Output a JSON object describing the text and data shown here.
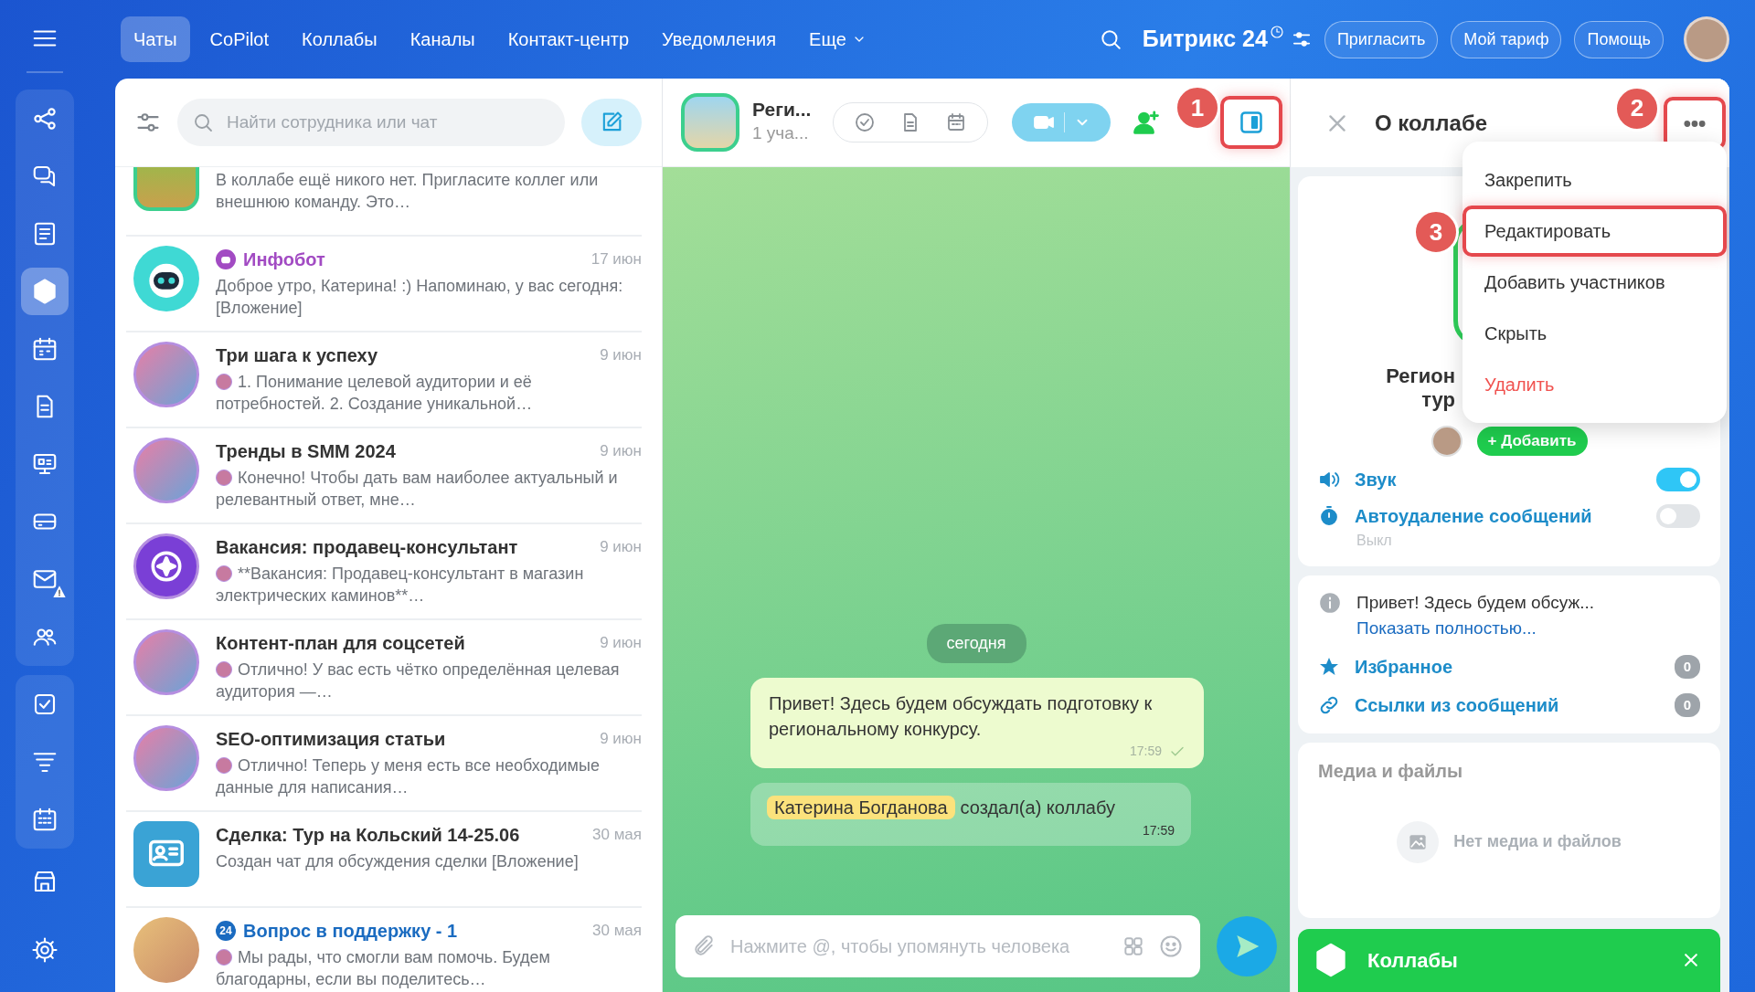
{
  "rail": {
    "top": [
      {
        "kind": "menu",
        "selected": false
      }
    ],
    "groups": [
      [
        {
          "kind": "flow",
          "selected": false,
          "alert": false
        },
        {
          "kind": "chat",
          "selected": false,
          "alert": false
        },
        {
          "kind": "news",
          "selected": false,
          "alert": false
        },
        {
          "kind": "collab",
          "selected": true,
          "alert": false
        },
        {
          "kind": "calendar",
          "selected": false,
          "alert": false
        },
        {
          "kind": "doc",
          "selected": false,
          "alert": false
        },
        {
          "kind": "board",
          "selected": false,
          "alert": false
        },
        {
          "kind": "drive",
          "selected": false,
          "alert": false
        },
        {
          "kind": "mail",
          "selected": false,
          "alert": true
        },
        {
          "kind": "people",
          "selected": false,
          "alert": false
        }
      ],
      [
        {
          "kind": "tasks",
          "selected": false,
          "alert": false
        },
        {
          "kind": "filter",
          "selected": false,
          "alert": false
        },
        {
          "kind": "planner",
          "selected": false,
          "alert": false
        }
      ]
    ],
    "bottom": [
      {
        "kind": "store",
        "selected": false
      },
      {
        "kind": "settings",
        "selected": false
      }
    ]
  },
  "tabs": [
    {
      "label": "Чаты",
      "selected": true,
      "dropdown": false
    },
    {
      "label": "CoPilot",
      "selected": false,
      "dropdown": false
    },
    {
      "label": "Коллабы",
      "selected": false,
      "dropdown": false
    },
    {
      "label": "Каналы",
      "selected": false,
      "dropdown": false
    },
    {
      "label": "Контакт-центр",
      "selected": false,
      "dropdown": false
    },
    {
      "label": "Уведомления",
      "selected": false,
      "dropdown": false
    },
    {
      "label": "Еще",
      "selected": false,
      "dropdown": true
    }
  ],
  "brand": "Битрикс 24",
  "header_buttons": [
    "Пригласить",
    "Мой тариф",
    "Помощь"
  ],
  "search": {
    "placeholder": "Найти сотрудника или чат"
  },
  "chats": [
    {
      "kind": "collab",
      "bot_badge": false,
      "preview": "В коллабе ещё никого нет. Пригласите коллег или внешнюю команду. Это…",
      "preview_avatar": false
    },
    {
      "kind": "bot",
      "name": "Инфобот",
      "bot_badge": true,
      "color": "#a24bc3",
      "date": "17 июн",
      "preview": "Доброе утро, Катерина! :) Напоминаю, у вас сегодня: [Вложение]",
      "preview_avatar": false
    },
    {
      "kind": "photo",
      "bot_badge": false,
      "name": "Три шага к успеху",
      "color": "#333333",
      "date": "9 июн",
      "preview": "1. Понимание целевой аудитории и её потребностей. 2. Создание уникальной…",
      "preview_avatar": true
    },
    {
      "kind": "photo",
      "bot_badge": false,
      "name": "Тренды в SMM 2024",
      "color": "#333333",
      "date": "9 июн",
      "preview": "Конечно! Чтобы дать вам наиболее актуальный и релевантный ответ, мне…",
      "preview_avatar": true
    },
    {
      "kind": "logo",
      "bot_badge": false,
      "name": "Вакансия: продавец-консультант",
      "color": "#333333",
      "date": "9 июн",
      "preview": "**Вакансия: Продавец-консультант в магазин электрических каминов**…",
      "preview_avatar": true
    },
    {
      "kind": "photo",
      "bot_badge": false,
      "name": "Контент-план для соцсетей",
      "color": "#333333",
      "date": "9 июн",
      "preview": "Отлично! У вас есть чётко определённая целевая аудитория —…",
      "preview_avatar": true
    },
    {
      "kind": "photo",
      "bot_badge": false,
      "name": "SEO-оптимизация статьи",
      "color": "#333333",
      "date": "9 июн",
      "preview": "Отлично! Теперь у меня есть все необходимые данные для написания…",
      "preview_avatar": true
    },
    {
      "kind": "deal",
      "bot_badge": false,
      "name": "Сделка: Тур на Кольский 14-25.06",
      "color": "#333333",
      "date": "30 мая",
      "preview": "Создан чат для обсуждения сделки [Вложение]",
      "preview_avatar": false
    },
    {
      "kind": "group",
      "bot_badge": false,
      "name": "Вопрос в поддержку - 1",
      "name_badge": "24",
      "color": "#1a6bc0",
      "date": "30 мая",
      "preview": "Мы рады, что смогли вам помочь. Будем благодарны, если вы поделитесь…",
      "preview_avatar": true
    }
  ],
  "chat": {
    "title": "Реги...",
    "subtitle": "1 уча...",
    "panel_callout": "1",
    "date_divider": "сегодня",
    "messages": [
      {
        "kind": "text",
        "text": "Привет! Здесь будем обсуждать подготовку к региональному конкурсу.",
        "time": "17:59",
        "read": true
      },
      {
        "kind": "system",
        "author": "Катерина Богданова",
        "text": "создал(а) коллабу",
        "time": "17:59"
      }
    ],
    "input": {
      "placeholder": "Нажмите @, чтобы упомянуть человека"
    }
  },
  "info": {
    "title": "О коллабе",
    "more_callout": "2",
    "menu": [
      {
        "label": "Закрепить",
        "kind": "normal"
      },
      {
        "label": "Редактировать",
        "kind": "normal",
        "callout": "3"
      },
      {
        "label": "Добавить участников",
        "kind": "normal"
      },
      {
        "label": "Скрыть",
        "kind": "normal"
      },
      {
        "label": "Удалить",
        "kind": "danger"
      }
    ],
    "name_lines": [
      "Регион",
      "тур"
    ],
    "add_button": "+ Добавить",
    "settings": [
      {
        "label": "Звук",
        "kind": "sound",
        "on": true
      },
      {
        "label": "Автоудаление сообщений",
        "kind": "timer",
        "on": false,
        "note": "Выкл"
      }
    ],
    "description": {
      "text": "Привет! Здесь будем обсуж...",
      "link": "Показать полностью..."
    },
    "counters": [
      {
        "label": "Избранное",
        "kind": "star",
        "count": "0"
      },
      {
        "label": "Ссылки из сообщений",
        "kind": "link",
        "count": "0"
      }
    ],
    "media": {
      "title": "Медиа и файлы",
      "empty": "Нет медиа и файлов"
    },
    "banner": {
      "title": "Коллабы"
    }
  }
}
